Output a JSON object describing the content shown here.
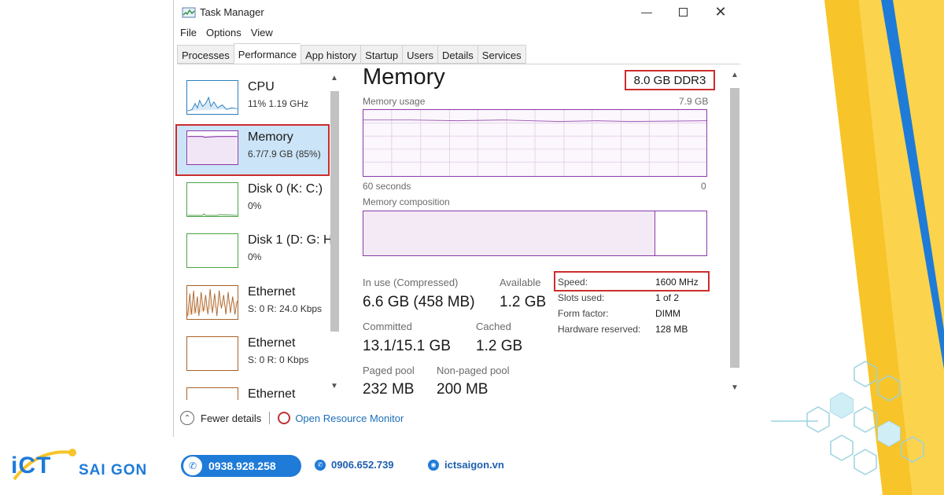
{
  "window": {
    "title": "Task Manager",
    "menu": [
      "File",
      "Options",
      "View"
    ],
    "tabs": [
      "Processes",
      "Performance",
      "App history",
      "Startup",
      "Users",
      "Details",
      "Services"
    ],
    "active_tab": "Performance"
  },
  "sidebar": {
    "items": [
      {
        "name": "CPU",
        "sub": "11%  1.19 GHz"
      },
      {
        "name": "Memory",
        "sub": "6.7/7.9 GB (85%)"
      },
      {
        "name": "Disk 0 (K: C:)",
        "sub": "0%"
      },
      {
        "name": "Disk 1 (D: G: H",
        "sub": "0%"
      },
      {
        "name": "Ethernet",
        "sub": "S: 0 R: 24.0 Kbps"
      },
      {
        "name": "Ethernet",
        "sub": "S: 0 R: 0 Kbps"
      },
      {
        "name": "Ethernet",
        "sub": ""
      }
    ],
    "selected_index": 1
  },
  "main": {
    "title": "Memory",
    "capacity": "8.0 GB DDR3",
    "usage_label": "Memory usage",
    "usage_max": "7.9 GB",
    "time_left": "60 seconds",
    "time_right": "0",
    "composition_label": "Memory composition",
    "composition_in_use_fraction": 0.85,
    "stats": {
      "in_use_label": "In use (Compressed)",
      "in_use_value": "6.6 GB (458 MB)",
      "available_label": "Available",
      "available_value": "1.2 GB",
      "committed_label": "Committed",
      "committed_value": "13.1/15.1 GB",
      "cached_label": "Cached",
      "cached_value": "1.2 GB",
      "paged_label": "Paged pool",
      "paged_value": "232 MB",
      "nonpaged_label": "Non-paged pool",
      "nonpaged_value": "200 MB"
    },
    "details": {
      "speed_label": "Speed:",
      "speed_value": "1600 MHz",
      "slots_label": "Slots used:",
      "slots_value": "1 of 2",
      "form_label": "Form factor:",
      "form_value": "DIMM",
      "hw_label": "Hardware reserved:",
      "hw_value": "128 MB"
    }
  },
  "bottom": {
    "fewer_details": "Fewer details",
    "resource_monitor": "Open Resource Monitor"
  },
  "footer": {
    "brand_main": "iCT",
    "brand_sub": "SAI GON",
    "phone1": "0938.928.258",
    "phone2": "0906.652.739",
    "website": "ictsaigon.vn"
  },
  "colors": {
    "highlight_red": "#cc2d2d",
    "memory_purple": "#8b3aa8",
    "brand_blue": "#1e7bd8",
    "stripe_yellow": "#f7c429"
  }
}
